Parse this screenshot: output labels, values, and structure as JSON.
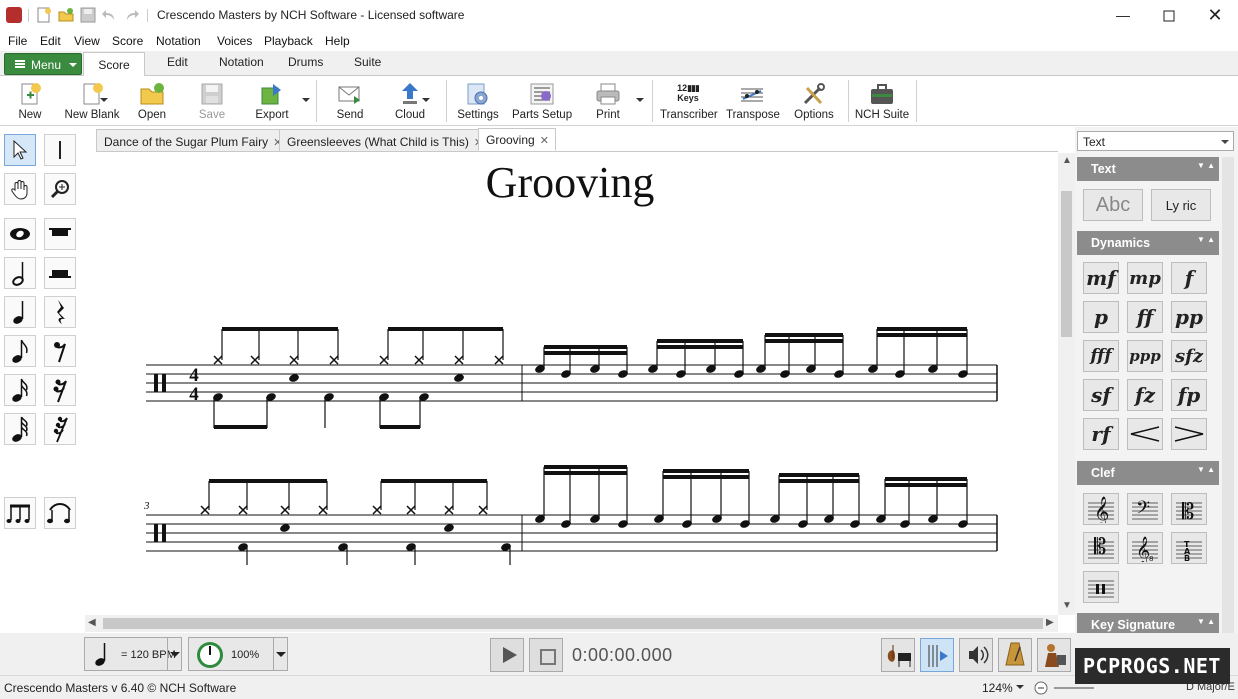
{
  "window": {
    "title": "Crescendo Masters by NCH Software - Licensed software",
    "controls": [
      "minimize",
      "maximize",
      "close"
    ]
  },
  "menubar": [
    "File",
    "Edit",
    "View",
    "Score",
    "Notation",
    "Voices",
    "Playback",
    "Help"
  ],
  "ribbon_tabs": {
    "menu_label": "Menu",
    "tabs": [
      "Score",
      "Edit",
      "Notation",
      "Drums",
      "Suite"
    ],
    "active": "Score"
  },
  "toolbar": {
    "new": "New",
    "new_blank": "New Blank",
    "open": "Open",
    "save": "Save",
    "export": "Export",
    "send": "Send",
    "cloud": "Cloud",
    "settings": "Settings",
    "parts_setup": "Parts Setup",
    "print": "Print",
    "transcriber": "Transcriber",
    "transcriber_icon_text": "12\nKeys",
    "transpose": "Transpose",
    "options": "Options",
    "nch_suite": "NCH Suite"
  },
  "doc_tabs": [
    {
      "label": "Dance of the Sugar Plum Fairy",
      "active": false
    },
    {
      "label": "Greensleeves (What Child is This)",
      "active": false
    },
    {
      "label": "Grooving",
      "active": true
    }
  ],
  "score": {
    "title": "Grooving",
    "time_signature": {
      "top": "4",
      "bottom": "4"
    },
    "second_system_measure_number": "3"
  },
  "right_panel": {
    "dropdown_value": "Text",
    "sections": {
      "text": {
        "header": "Text",
        "buttons": [
          "Abc",
          "Ly ric"
        ]
      },
      "dynamics": {
        "header": "Dynamics",
        "buttons": [
          "mf",
          "mp",
          "f",
          "p",
          "ff",
          "pp",
          "fff",
          "ppp",
          "sfz",
          "sf",
          "fz",
          "fp",
          "rf",
          "<",
          ">"
        ]
      },
      "clef": {
        "header": "Clef",
        "buttons": [
          "𝄞",
          "𝄢",
          "𝄡",
          "𝄡",
          "𝄞",
          "𝄡",
          "𝄥"
        ]
      },
      "key_signature": {
        "header": "Key Signature"
      }
    }
  },
  "bottombar": {
    "tempo": "= 120 BPM",
    "speed": "100%",
    "time": "0:00:00.000"
  },
  "statusbar": {
    "text": "Crescendo Masters v 6.40 © NCH Software",
    "zoom": "124%",
    "key_partial": "D Major/E"
  },
  "watermark": "PCPROGS.NET",
  "colors": {
    "menu_green": "#3a8a3f",
    "panel_header": "#8c8c8c"
  }
}
